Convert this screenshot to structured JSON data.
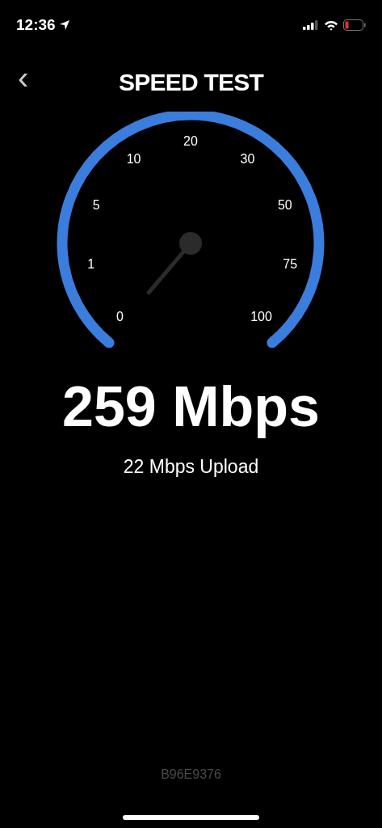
{
  "status_bar": {
    "time": "12:36"
  },
  "header": {
    "back": "‹",
    "title": "SPEED TEST"
  },
  "gauge": {
    "labels": [
      "0",
      "1",
      "5",
      "10",
      "20",
      "30",
      "50",
      "75",
      "100"
    ]
  },
  "result": {
    "download": "259 Mbps",
    "upload": "22 Mbps Upload"
  },
  "footer": {
    "code": "B96E9376"
  }
}
